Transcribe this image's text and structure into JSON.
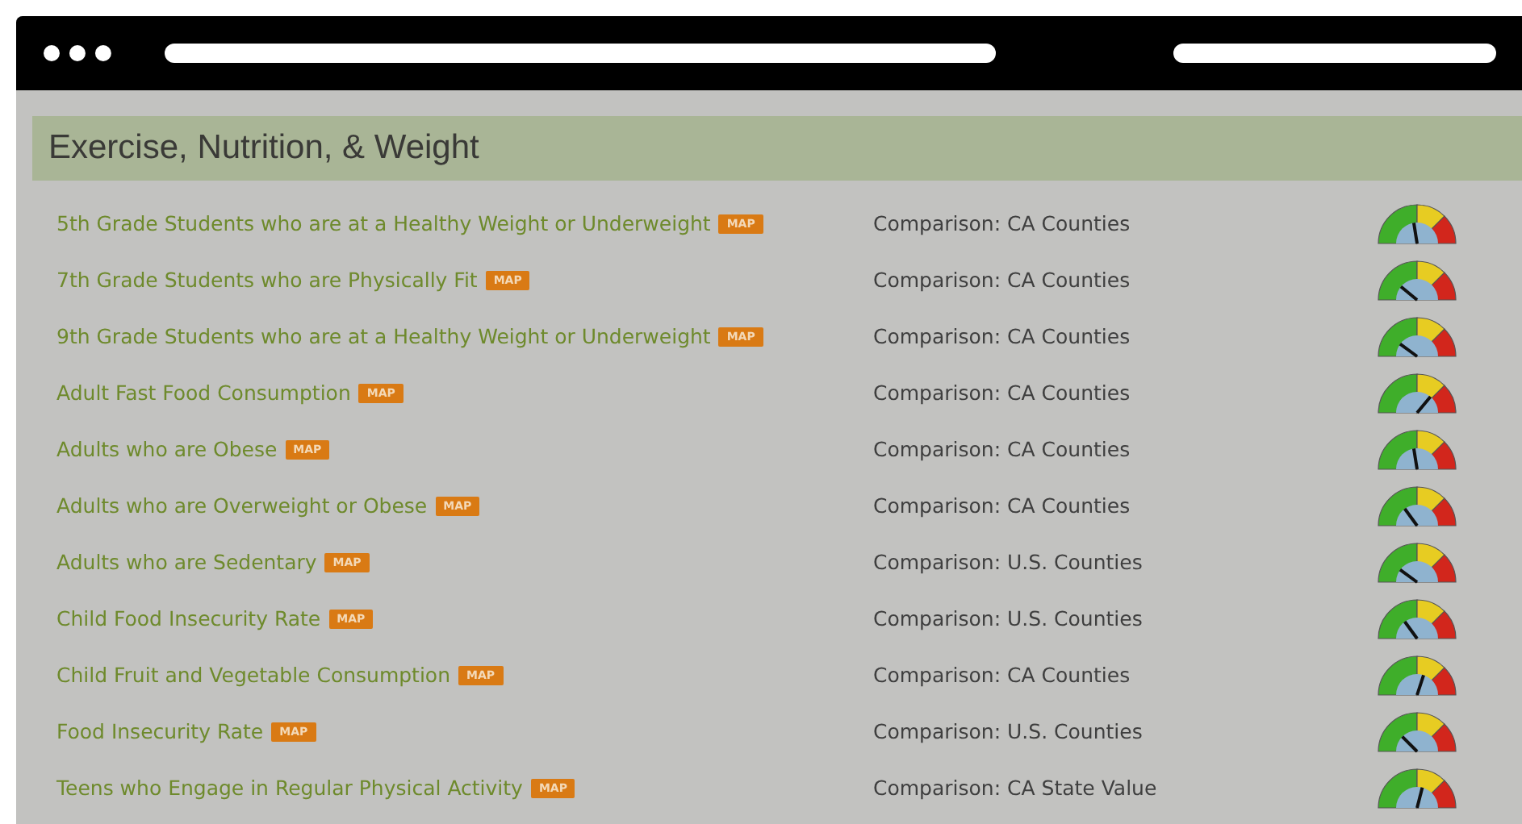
{
  "section": {
    "title": "Exercise, Nutrition, & Weight"
  },
  "rows": [
    {
      "indicator": "5th Grade Students who are at a Healthy Weight or Underweight",
      "badge": "MAP",
      "comparison": "Comparison: CA Counties",
      "level": 0.45
    },
    {
      "indicator": "7th Grade Students who are Physically Fit",
      "badge": "MAP",
      "comparison": "Comparison: CA Counties",
      "level": 0.22
    },
    {
      "indicator": "9th Grade Students who are at a Healthy Weight or Underweight",
      "badge": "MAP",
      "comparison": "Comparison: CA Counties",
      "level": 0.2
    },
    {
      "indicator": "Adult Fast Food Consumption",
      "badge": "MAP",
      "comparison": "Comparison: CA Counties",
      "level": 0.72
    },
    {
      "indicator": "Adults who are Obese",
      "badge": "MAP",
      "comparison": "Comparison: CA Counties",
      "level": 0.45
    },
    {
      "indicator": "Adults who are Overweight or Obese",
      "badge": "MAP",
      "comparison": "Comparison: CA Counties",
      "level": 0.3
    },
    {
      "indicator": "Adults who are Sedentary",
      "badge": "MAP",
      "comparison": "Comparison: U.S. Counties",
      "level": 0.2
    },
    {
      "indicator": "Child Food Insecurity Rate",
      "badge": "MAP",
      "comparison": "Comparison: U.S. Counties",
      "level": 0.3
    },
    {
      "indicator": "Child Fruit and Vegetable Consumption",
      "badge": "MAP",
      "comparison": "Comparison: CA Counties",
      "level": 0.6
    },
    {
      "indicator": "Food Insecurity Rate",
      "badge": "MAP",
      "comparison": "Comparison: U.S. Counties",
      "level": 0.25
    },
    {
      "indicator": "Teens who Engage in Regular Physical Activity",
      "badge": "MAP",
      "comparison": "Comparison: CA State Value",
      "level": 0.58
    }
  ]
}
